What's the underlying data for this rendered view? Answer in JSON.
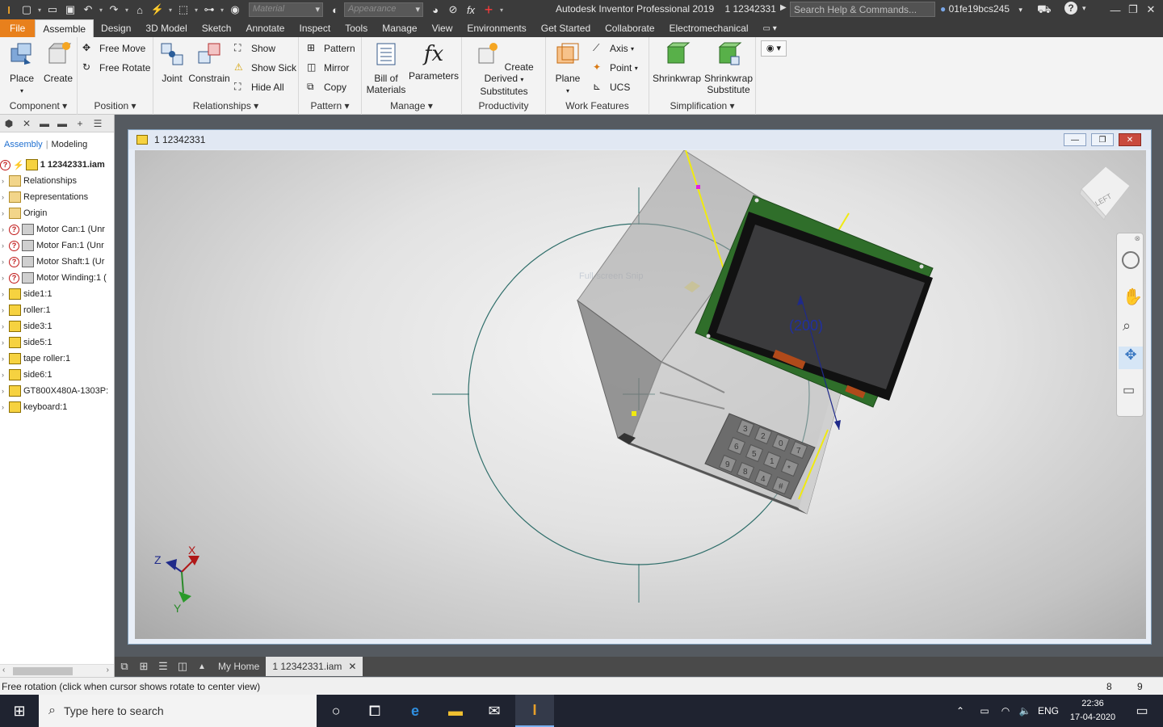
{
  "titlebar": {
    "material_placeholder": "Material",
    "appearance_placeholder": "Appearance",
    "app_title": "Autodesk Inventor Professional 2019",
    "document_title": "1 12342331",
    "search_placeholder": "Search Help & Commands...",
    "user": "01fe19bcs245",
    "help": "?"
  },
  "tabs": [
    "File",
    "Assemble",
    "Design",
    "3D Model",
    "Sketch",
    "Annotate",
    "Inspect",
    "Tools",
    "Manage",
    "View",
    "Environments",
    "Get Started",
    "Collaborate",
    "Electromechanical"
  ],
  "active_tab": "Assemble",
  "ribbon": {
    "component": {
      "title": "Component",
      "place": "Place",
      "create": "Create"
    },
    "position": {
      "title": "Position",
      "free_move": "Free Move",
      "free_rotate": "Free Rotate"
    },
    "relationships": {
      "title": "Relationships",
      "joint": "Joint",
      "constrain": "Constrain",
      "show": "Show",
      "show_sick": "Show Sick",
      "hide_all": "Hide All"
    },
    "pattern": {
      "title": "Pattern",
      "pattern": "Pattern",
      "mirror": "Mirror",
      "copy": "Copy"
    },
    "manage": {
      "title": "Manage",
      "bom_line1": "Bill of",
      "bom_line2": "Materials",
      "parameters": "Parameters"
    },
    "productivity": {
      "title": "Productivity",
      "line1": "Create Derived",
      "line2": "Substitutes"
    },
    "work_features": {
      "title": "Work Features",
      "plane": "Plane",
      "axis": "Axis",
      "point": "Point",
      "ucs": "UCS"
    },
    "simplification": {
      "title": "Simplification",
      "shrinkwrap": "Shrinkwrap",
      "shrinkwrap_sub_line1": "Shrinkwrap",
      "shrinkwrap_sub_line2": "Substitute"
    }
  },
  "browser": {
    "tab_assembly": "Assembly",
    "tab_modeling": "Modeling",
    "root": "1 12342331.iam",
    "items": [
      {
        "label": "Relationships",
        "icon": "folder-icon",
        "warn": false
      },
      {
        "label": "Representations",
        "icon": "representations-icon",
        "warn": false
      },
      {
        "label": "Origin",
        "icon": "folder-icon",
        "warn": false
      },
      {
        "label": "Motor Can:1 (Unr",
        "icon": "motor-icon",
        "warn": true
      },
      {
        "label": "Motor Fan:1 (Unr",
        "icon": "part-grey-icon",
        "warn": true
      },
      {
        "label": "Motor Shaft:1 (Ur",
        "icon": "part-grey-icon",
        "warn": true
      },
      {
        "label": "Motor Winding:1 (",
        "icon": "part-grey-icon",
        "warn": true
      },
      {
        "label": "side1:1",
        "icon": "part-icon",
        "warn": false
      },
      {
        "label": "roller:1",
        "icon": "part-icon",
        "warn": false
      },
      {
        "label": "side3:1",
        "icon": "part-icon",
        "warn": false
      },
      {
        "label": "side5:1",
        "icon": "part-icon",
        "warn": false
      },
      {
        "label": "tape roller:1",
        "icon": "part-icon",
        "warn": false
      },
      {
        "label": "side6:1",
        "icon": "part-icon",
        "warn": false
      },
      {
        "label": "GT800X480A-1303P:",
        "icon": "part-icon",
        "warn": false
      },
      {
        "label": "keyboard:1",
        "icon": "part-icon",
        "warn": false
      }
    ]
  },
  "document_window": {
    "title": "1 12342331",
    "dimension_label": "(200)",
    "snip_hint": "Full-screen Snip",
    "viewcube_face": "LEFT",
    "triad": {
      "x": "X",
      "y": "Y",
      "z": "Z"
    },
    "keypad_keys": [
      "3",
      "6",
      "9",
      "2",
      "5",
      "8",
      "0",
      "1",
      "4",
      "7",
      "*",
      "#"
    ]
  },
  "doc_tabs": {
    "home": "My Home",
    "active": "1 12342331.iam"
  },
  "status": {
    "message": "Free rotation (click when cursor shows rotate to center view)",
    "count1": "8",
    "count2": "9"
  },
  "taskbar": {
    "search_placeholder": "Type here to search",
    "lang": "ENG",
    "time": "22:36",
    "date": "17-04-2020"
  },
  "colors": {
    "accent_file": "#e8801c",
    "titlebar": "#3b3b3b",
    "ribbon": "#f3f3f3",
    "pcb_green": "#2f6e2a",
    "guide_yellow": "#f0ea10"
  }
}
